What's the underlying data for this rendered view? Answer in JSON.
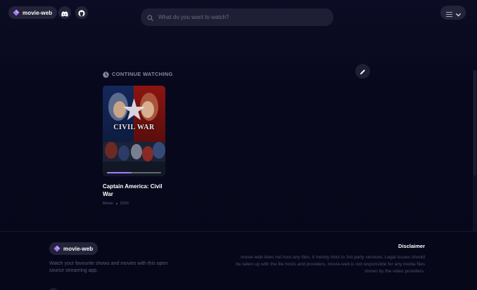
{
  "header": {
    "brand_label": "movie-web",
    "discord_icon": "discord-icon",
    "github_icon": "github-icon",
    "search": {
      "placeholder": "What do you want to watch?",
      "value": ""
    },
    "menu_icon": "hamburger-icon",
    "menu_chevron": "chevron-down-icon"
  },
  "continue_watching": {
    "title": "CONTINUE WATCHING",
    "icon": "clock-icon",
    "edit_icon": "pencil-icon",
    "items": [
      {
        "title": "Captain America: Civil War",
        "type": "Movie",
        "year": "2016",
        "poster_text": "CIVIL WAR",
        "progress": 0.45
      }
    ]
  },
  "footer": {
    "brand_label": "movie-web",
    "tagline": "Watch your favourite shows and movies with this open source streaming app.",
    "disclaimer_title": "Disclaimer",
    "disclaimer_text": "movie-web does not host any files, it merely links to 3rd party services. Legal issues should be taken up with the file hosts and providers. movie-web is not responsible for any media files shown by the video providers."
  },
  "colors": {
    "background": "#07071a",
    "accent": "#a57bff",
    "pill": "#232339"
  }
}
